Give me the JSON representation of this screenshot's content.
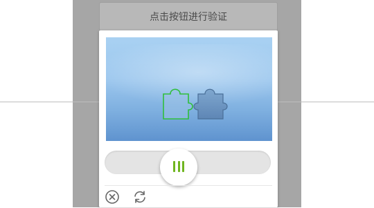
{
  "header": {
    "verify_text": "点击按钮进行验证"
  },
  "captcha": {
    "slider_position": 0.42,
    "icons": {
      "close": "close-circle-icon",
      "refresh": "refresh-icon"
    }
  },
  "colors": {
    "overlay": "#a6a6a6",
    "accent": "#6fb51f",
    "sky_top": "#a9d1f2",
    "sky_bottom": "#5f93cf"
  }
}
